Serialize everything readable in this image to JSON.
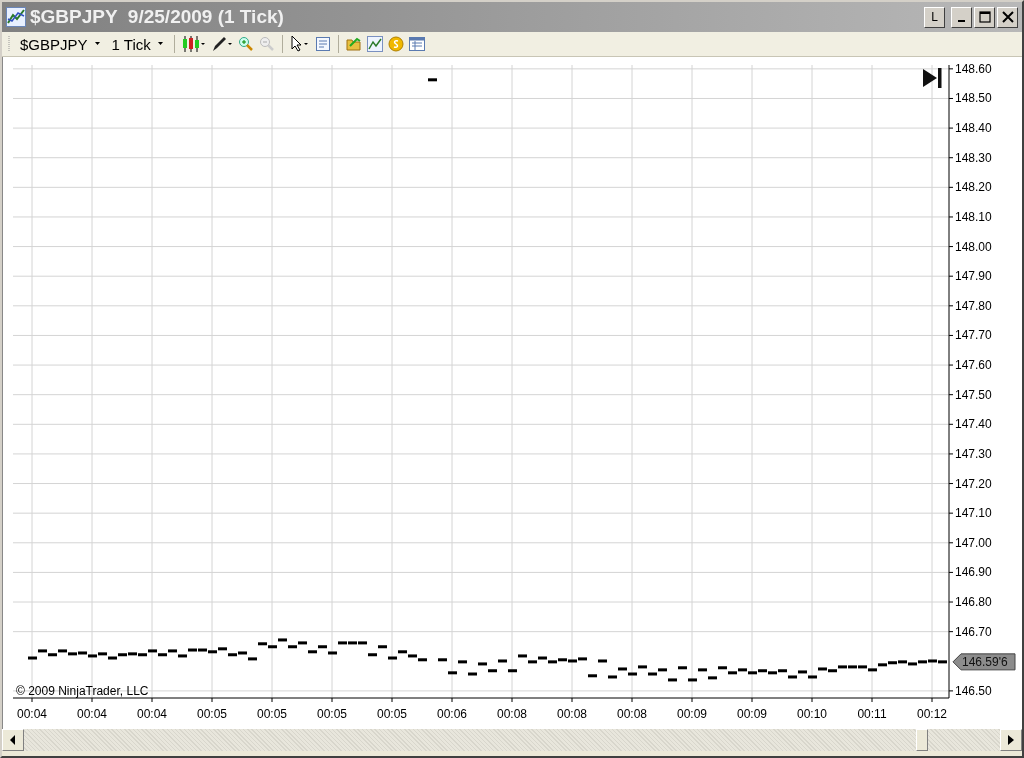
{
  "window": {
    "title": "$GBPJPY  9/25/2009 (1 Tick)",
    "layout_button": "L"
  },
  "toolbar": {
    "instrument": "$GBPJPY",
    "interval": "1 Tick"
  },
  "chart": {
    "copyright": "© 2009 NinjaTrader, LLC",
    "last_price": "146.59'6",
    "chart_data": {
      "type": "scatter",
      "categories": [
        "00:04",
        null,
        null,
        null,
        null,
        null,
        "00:04",
        null,
        null,
        null,
        null,
        null,
        "00:04",
        null,
        null,
        null,
        null,
        null,
        "00:05",
        null,
        null,
        null,
        null,
        null,
        "00:05",
        null,
        null,
        null,
        null,
        null,
        "00:05",
        null,
        null,
        null,
        null,
        null,
        "00:05",
        null,
        null,
        null,
        null,
        null,
        "00:06",
        null,
        null,
        null,
        null,
        null,
        "00:08",
        null,
        null,
        null,
        null,
        null,
        "00:08",
        null,
        null,
        null,
        null,
        null,
        "00:08",
        null,
        null,
        null,
        null,
        null,
        "00:09",
        null,
        null,
        null,
        null,
        null,
        "00:09",
        null,
        null,
        null,
        null,
        null,
        "00:10",
        null,
        null,
        null,
        null,
        null,
        "00:11",
        null,
        null,
        null,
        null,
        null,
        "00:12",
        null
      ],
      "series": [
        {
          "color": "#000000",
          "values": [
            146.611,
            146.635,
            146.622,
            146.635,
            146.625,
            146.628,
            146.618,
            146.625,
            146.611,
            146.622,
            146.625,
            146.622,
            146.635,
            146.622,
            146.635,
            146.618,
            146.638,
            146.638,
            146.632,
            146.642,
            146.622,
            146.628,
            146.608,
            146.659,
            146.649,
            146.672,
            146.649,
            146.662,
            146.632,
            146.649,
            146.628,
            146.662,
            146.662,
            146.662,
            146.622,
            146.649,
            146.611,
            146.632,
            146.618,
            146.605,
            148.563,
            146.605,
            146.561,
            146.598,
            146.557,
            146.591,
            146.568,
            146.601,
            146.568,
            146.618,
            146.598,
            146.611,
            146.598,
            146.605,
            146.601,
            146.608,
            146.551,
            146.601,
            146.547,
            146.574,
            146.557,
            146.581,
            146.557,
            146.571,
            146.537,
            146.578,
            146.537,
            146.571,
            146.544,
            146.578,
            146.561,
            146.571,
            146.561,
            146.568,
            146.561,
            146.568,
            146.547,
            146.564,
            146.547,
            146.574,
            146.568,
            146.581,
            146.581,
            146.581,
            146.571,
            146.588,
            146.595,
            146.598,
            146.591,
            146.598,
            146.601,
            146.598
          ]
        }
      ],
      "ylim": [
        146.476,
        148.613
      ],
      "grid": true,
      "yticks": [
        {
          "value": 146.5,
          "label": "146.50"
        },
        {
          "value": 146.7,
          "label": "146.70"
        },
        {
          "value": 146.8,
          "label": "146.80"
        },
        {
          "value": 146.9,
          "label": "146.90"
        },
        {
          "value": 147.0,
          "label": "147.00"
        },
        {
          "value": 147.1,
          "label": "147.10"
        },
        {
          "value": 147.2,
          "label": "147.20"
        },
        {
          "value": 147.3,
          "label": "147.30"
        },
        {
          "value": 147.4,
          "label": "147.40"
        },
        {
          "value": 147.5,
          "label": "147.50"
        },
        {
          "value": 147.6,
          "label": "147.60"
        },
        {
          "value": 147.7,
          "label": "147.70"
        },
        {
          "value": 147.8,
          "label": "147.80"
        },
        {
          "value": 147.9,
          "label": "147.90"
        },
        {
          "value": 148.0,
          "label": "148.00"
        },
        {
          "value": 148.1,
          "label": "148.10"
        },
        {
          "value": 148.2,
          "label": "148.20"
        },
        {
          "value": 148.3,
          "label": "148.30"
        },
        {
          "value": 148.4,
          "label": "148.40"
        },
        {
          "value": 148.5,
          "label": "148.50"
        },
        {
          "value": 148.6,
          "label": "148.60"
        }
      ]
    }
  }
}
